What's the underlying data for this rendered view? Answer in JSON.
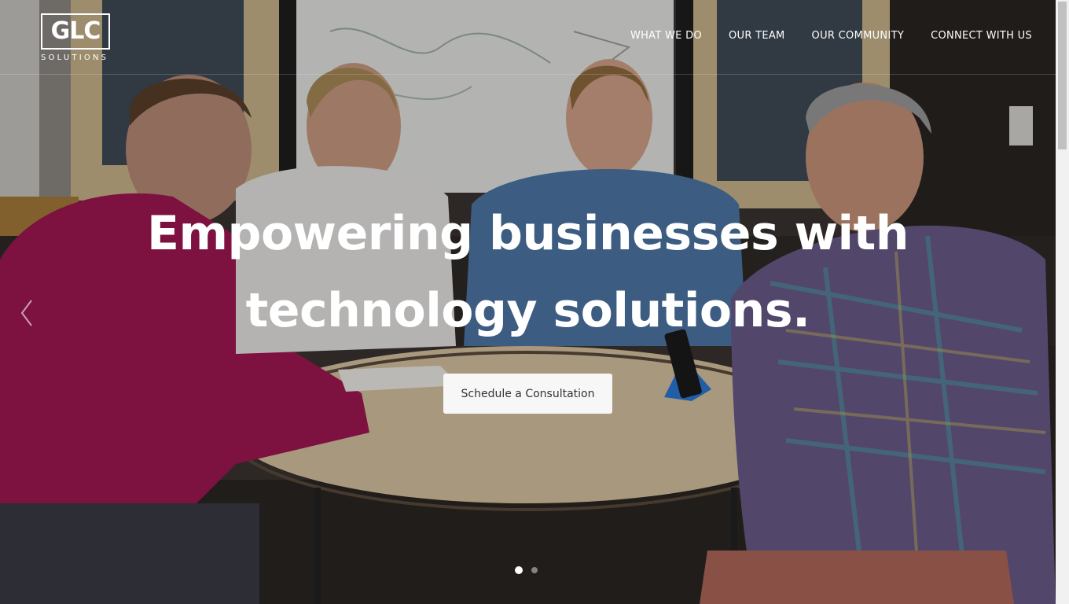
{
  "brand": {
    "logo_mark": "GLC",
    "logo_sub": "SOLUTIONS"
  },
  "nav": {
    "items": [
      {
        "label": "WHAT WE DO"
      },
      {
        "label": "OUR TEAM"
      },
      {
        "label": "OUR COMMUNITY"
      },
      {
        "label": "CONNECT WITH US"
      }
    ]
  },
  "hero": {
    "headline_line1": "Empowering businesses with",
    "headline_line2": "technology solutions.",
    "cta_label": "Schedule a Consultation",
    "slide_count": 2,
    "active_slide": 1,
    "prev_icon": "chevron-left-icon"
  },
  "colors": {
    "text": "#ffffff",
    "button_bg": "#f7f7f7",
    "button_text": "#333333"
  }
}
